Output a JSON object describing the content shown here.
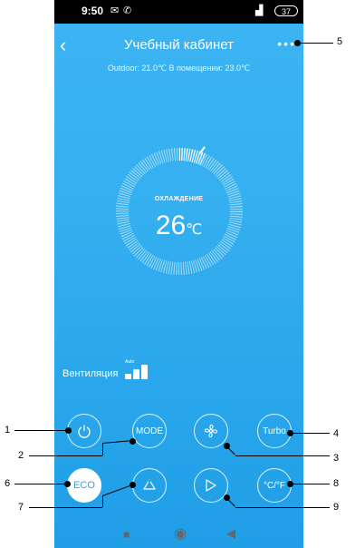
{
  "status_bar": {
    "time": "9:50",
    "battery": "37"
  },
  "header": {
    "title": "Учебный кабинет",
    "back_icon": "chevron-left-icon",
    "more_icon": "more-dots-icon"
  },
  "info": {
    "outdoor_text": "Outdoor: 21.0℃ В помещении: 23.0℃"
  },
  "dial": {
    "mode": "ОХЛАЖДЕНИЕ",
    "temperature": "26",
    "unit": "℃"
  },
  "ventilation": {
    "label": "Вентиляция",
    "auto": "Auto"
  },
  "buttons": {
    "power_icon": "power-icon",
    "mode": "MODE",
    "fan_icon": "fan-icon",
    "turbo": "Turbo",
    "eco": "ECO",
    "swing_vertical_icon": "swing-vertical-icon",
    "swing_horizontal_icon": "swing-horizontal-icon",
    "units": "°C/°F"
  },
  "annotations": {
    "n1": "1",
    "n2": "2",
    "n3": "3",
    "n4": "4",
    "n5": "5",
    "n6": "6",
    "n7": "7",
    "n8": "8",
    "n9": "9"
  },
  "colors": {
    "accent": "#2aa7ec",
    "background_top": "#3db4f2"
  }
}
